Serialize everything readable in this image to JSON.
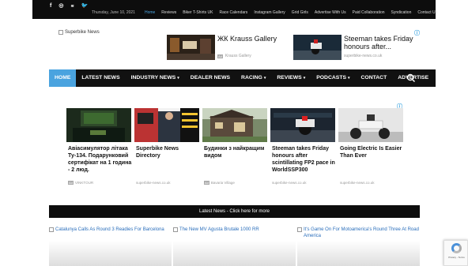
{
  "topbar": {
    "social": [
      "f",
      "◎",
      "RSS",
      "t"
    ],
    "date": "Thursday, June 10, 2021",
    "links": [
      {
        "label": "Home",
        "active": true
      },
      {
        "label": "Reviews"
      },
      {
        "label": "Biker T-Shirts UK"
      },
      {
        "label": "Race Calendars"
      },
      {
        "label": "Instagram Gallery"
      },
      {
        "label": "Grid Girls"
      },
      {
        "label": "Advertise With Us"
      },
      {
        "label": "Paid Collaboration"
      },
      {
        "label": "Syndication"
      },
      {
        "label": "Contact Us"
      }
    ]
  },
  "logo": {
    "alt": "Superbike News"
  },
  "top_ads": [
    {
      "title": "ЖК Krauss Gallery",
      "source": "Krauss Gallery",
      "tag": "Ad"
    },
    {
      "title": "Steeman takes Friday honours after...",
      "source": "superbike-news.co.uk",
      "tag": ""
    }
  ],
  "mainnav": [
    {
      "label": "HOME",
      "active": true,
      "dropdown": false
    },
    {
      "label": "LATEST NEWS",
      "dropdown": false
    },
    {
      "label": "INDUSTRY NEWS",
      "dropdown": true
    },
    {
      "label": "DEALER NEWS",
      "dropdown": false
    },
    {
      "label": "RACING",
      "dropdown": true
    },
    {
      "label": "REVIEWS",
      "dropdown": true
    },
    {
      "label": "PODCASTS",
      "dropdown": true
    },
    {
      "label": "CONTACT",
      "dropdown": false
    },
    {
      "label": "ADVERTISE",
      "dropdown": false
    }
  ],
  "cards": [
    {
      "title": "Авіасимулятор літака Ту-134. Подарунковий сертифікат на 1 година - 2 люд.",
      "source": "VINKTOUR",
      "tag": "Ad"
    },
    {
      "title": "Superbike News Directory",
      "source": "superbike-news.co.uk",
      "tag": ""
    },
    {
      "title": "Будинки з найкращим видом",
      "source": "Bavaria Village",
      "tag": "Ad"
    },
    {
      "title": "Steeman takes Friday honours after scintillating FP2 pace in WorldSSP300",
      "source": "superbike-news.co.uk",
      "tag": ""
    },
    {
      "title": "Going Electric Is Easier Than Ever",
      "source": "superbike-news.co.uk",
      "tag": ""
    }
  ],
  "latest_bar": "Latest News - Click here for more",
  "bottom_items": [
    "Catalunya Calls As Round 3 Readies For Barcelona",
    "The New MV Agusta Brutale 1000 RR",
    "It's Game On For Motoamerica's Round Three At Road America"
  ],
  "recaptcha": {
    "text": "Privacy - Terms"
  },
  "colors": {
    "accent": "#4aa3df",
    "bar": "#111111"
  }
}
